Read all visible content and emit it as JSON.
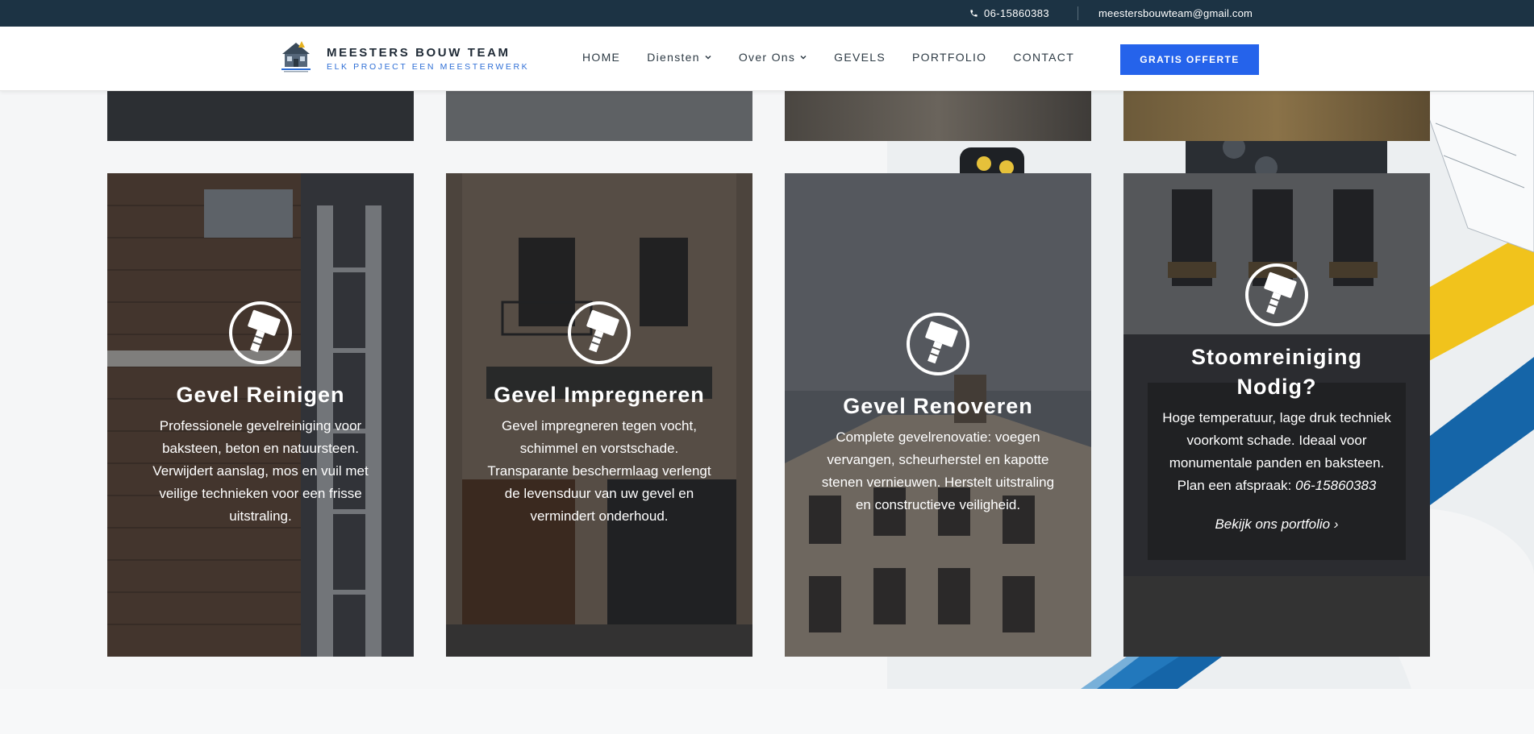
{
  "topbar": {
    "phone": "06-15860383",
    "email": "meestersbouwteam@gmail.com"
  },
  "header": {
    "brand_name": "MEESTERS BOUW TEAM",
    "brand_tagline": "ELK PROJECT EEN MEESTERWERK",
    "nav": [
      {
        "label": "HOME"
      },
      {
        "label": "Diensten"
      },
      {
        "label": "Over Ons"
      },
      {
        "label": "GEVELS"
      },
      {
        "label": "PORTFOLIO"
      },
      {
        "label": "CONTACT"
      }
    ],
    "cta_label": "GRATIS OFFERTE"
  },
  "cards": [
    {
      "title": "Gevel Reinigen",
      "text": "Professionele gevelreiniging voor baksteen, beton en natuursteen. Verwijdert aanslag, mos en vuil met veilige technieken voor een frisse uitstraling."
    },
    {
      "title": "Gevel Impregneren",
      "text": "Gevel impregneren tegen vocht, schimmel en vorstschade. Transparante beschermlaag verlengt de levensduur van uw gevel en vermindert onderhoud."
    },
    {
      "title": "Gevel Renoveren",
      "text": "Complete gevelrenovatie: voegen vervangen, scheurherstel en kapotte stenen vernieuwen. Herstelt uitstraling en constructieve veiligheid."
    },
    {
      "title": "Stoomreiniging Nodig?",
      "text": "Hoge temperatuur, lage druk techniek voorkomt schade. Ideaal voor monumentale panden en baksteen. Plan een afspraak:",
      "phone": "06-15860383",
      "link": "Bekijk ons portfolio ›"
    }
  ],
  "colors": {
    "topbar": "#1c3344",
    "accent": "#2563eb",
    "brand_tagline": "#2f6fd6"
  },
  "icons": {
    "phone": "phone-icon",
    "chevron": "chevron-down-icon",
    "hammer": "hammer-icon"
  }
}
